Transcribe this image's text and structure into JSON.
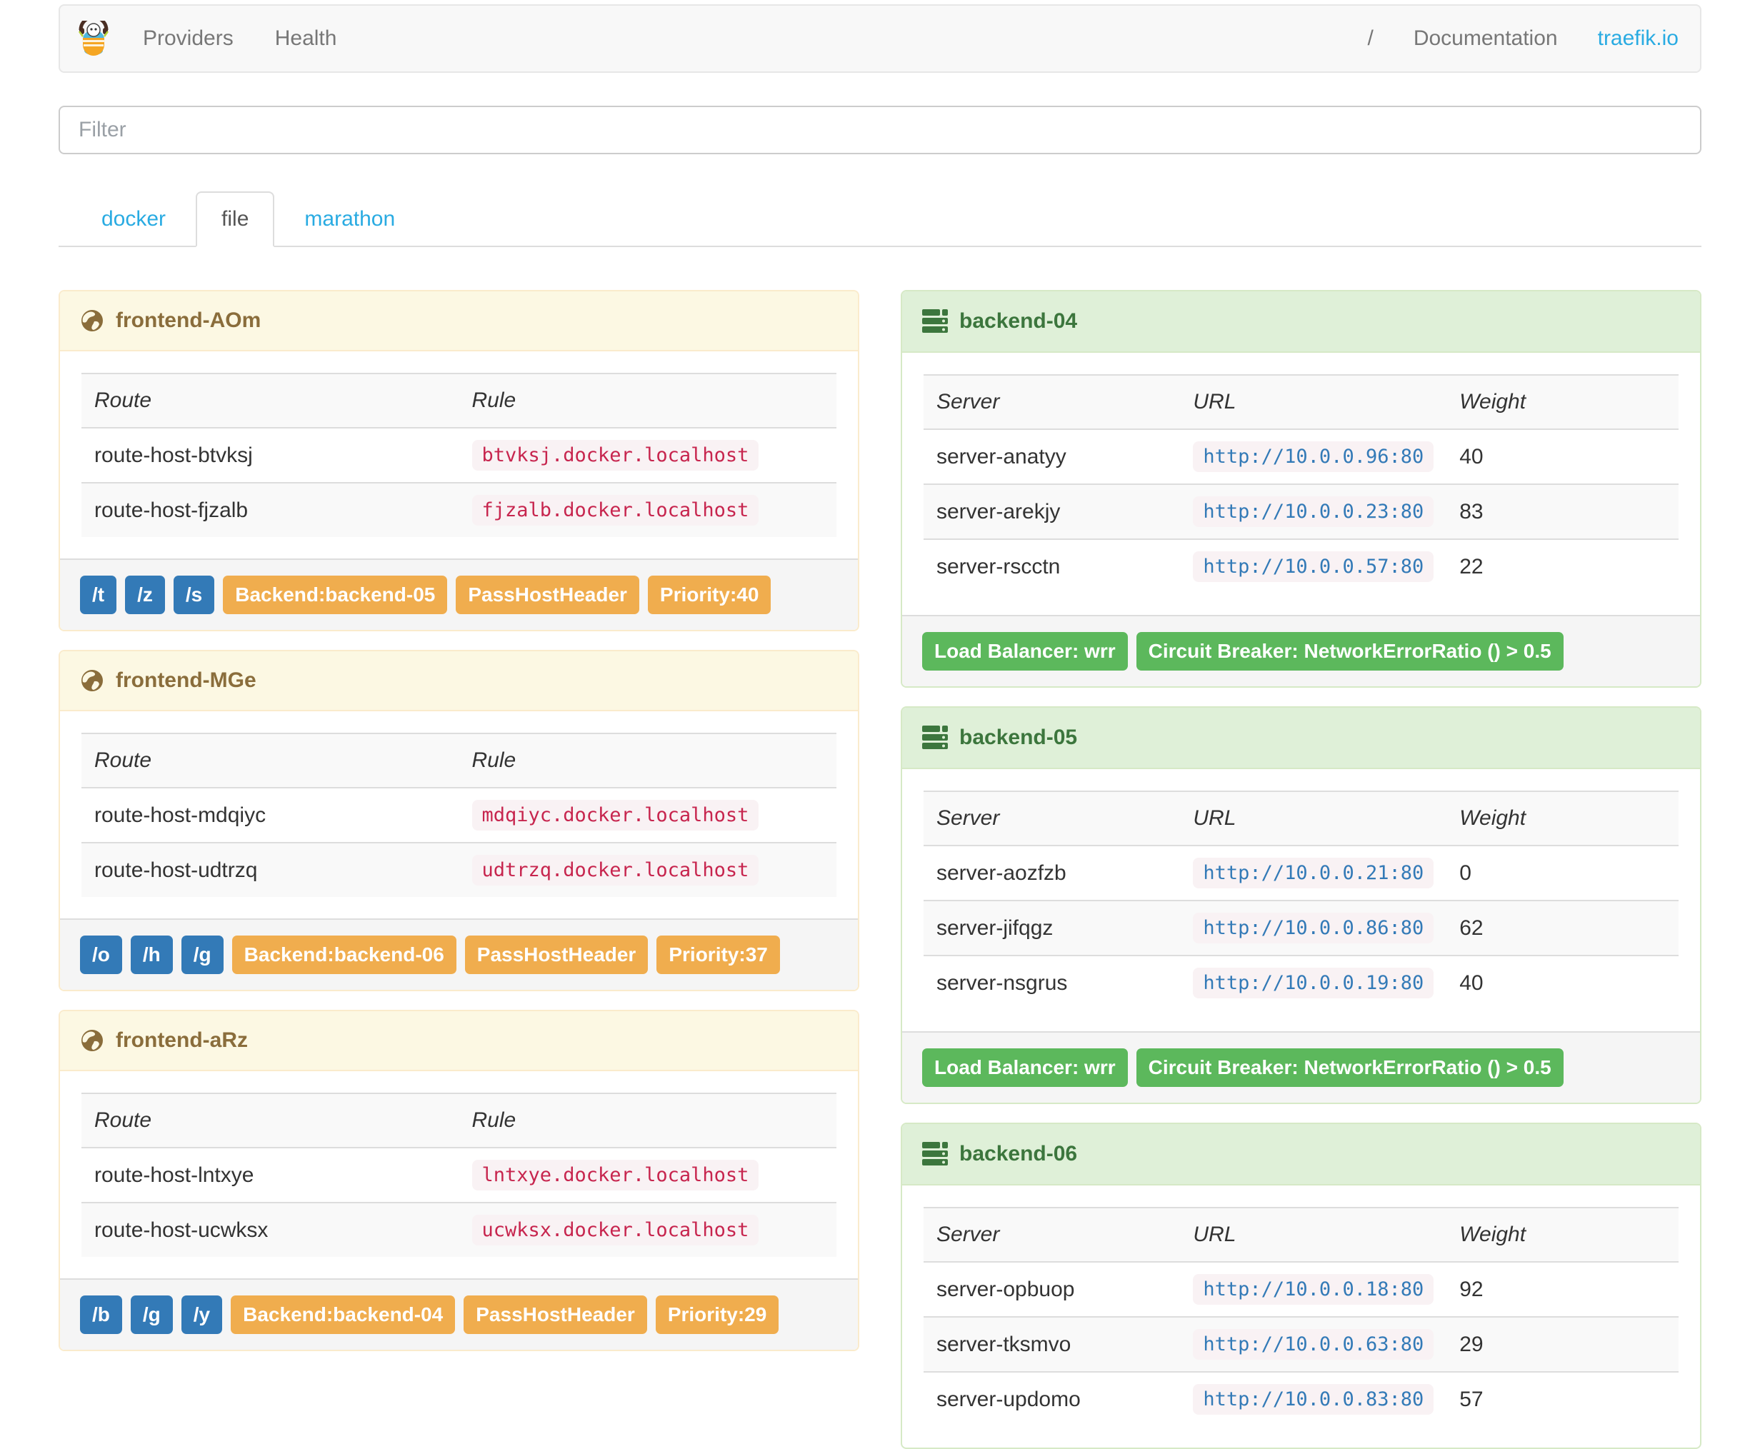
{
  "navbar": {
    "logo_icon": "traefik-logo",
    "items_left": [
      {
        "label": "Providers"
      },
      {
        "label": "Health"
      }
    ],
    "items_right": [
      {
        "label": "/"
      },
      {
        "label": "Documentation"
      }
    ],
    "brand_link": "traefik.io"
  },
  "filter": {
    "placeholder": "Filter"
  },
  "tabs": [
    {
      "label": "docker",
      "active": false
    },
    {
      "label": "file",
      "active": true
    },
    {
      "label": "marathon",
      "active": false
    }
  ],
  "table_labels": {
    "route": "Route",
    "rule": "Rule",
    "server": "Server",
    "url": "URL",
    "weight": "Weight"
  },
  "frontends": [
    {
      "name": "frontend-AOm",
      "icon": "globe-icon",
      "routes": [
        {
          "name": "route-host-btvksj",
          "rule": "btvksj.docker.localhost"
        },
        {
          "name": "route-host-fjzalb",
          "rule": "fjzalb.docker.localhost"
        }
      ],
      "entry_points": [
        "/t",
        "/z",
        "/s"
      ],
      "backend": "Backend:backend-05",
      "pass_host_header": "PassHostHeader",
      "priority": "Priority:40"
    },
    {
      "name": "frontend-MGe",
      "icon": "globe-icon",
      "routes": [
        {
          "name": "route-host-mdqiyc",
          "rule": "mdqiyc.docker.localhost"
        },
        {
          "name": "route-host-udtrzq",
          "rule": "udtrzq.docker.localhost"
        }
      ],
      "entry_points": [
        "/o",
        "/h",
        "/g"
      ],
      "backend": "Backend:backend-06",
      "pass_host_header": "PassHostHeader",
      "priority": "Priority:37"
    },
    {
      "name": "frontend-aRz",
      "icon": "globe-icon",
      "routes": [
        {
          "name": "route-host-lntxye",
          "rule": "lntxye.docker.localhost"
        },
        {
          "name": "route-host-ucwksx",
          "rule": "ucwksx.docker.localhost"
        }
      ],
      "entry_points": [
        "/b",
        "/g",
        "/y"
      ],
      "backend": "Backend:backend-04",
      "pass_host_header": "PassHostHeader",
      "priority": "Priority:29"
    }
  ],
  "backends": [
    {
      "name": "backend-04",
      "icon": "servers-icon",
      "servers": [
        {
          "name": "server-anatyy",
          "url": "http://10.0.0.96:80",
          "weight": "40"
        },
        {
          "name": "server-arekjy",
          "url": "http://10.0.0.23:80",
          "weight": "83"
        },
        {
          "name": "server-rscctn",
          "url": "http://10.0.0.57:80",
          "weight": "22"
        }
      ],
      "load_balancer": "Load Balancer: wrr",
      "circuit_breaker": "Circuit Breaker: NetworkErrorRatio () > 0.5"
    },
    {
      "name": "backend-05",
      "icon": "servers-icon",
      "servers": [
        {
          "name": "server-aozfzb",
          "url": "http://10.0.0.21:80",
          "weight": "0"
        },
        {
          "name": "server-jifqgz",
          "url": "http://10.0.0.86:80",
          "weight": "62"
        },
        {
          "name": "server-nsgrus",
          "url": "http://10.0.0.19:80",
          "weight": "40"
        }
      ],
      "load_balancer": "Load Balancer: wrr",
      "circuit_breaker": "Circuit Breaker: NetworkErrorRatio () > 0.5"
    },
    {
      "name": "backend-06",
      "icon": "servers-icon",
      "servers": [
        {
          "name": "server-opbuop",
          "url": "http://10.0.0.18:80",
          "weight": "92"
        },
        {
          "name": "server-tksmvo",
          "url": "http://10.0.0.63:80",
          "weight": "29"
        },
        {
          "name": "server-updomo",
          "url": "http://10.0.0.83:80",
          "weight": "57"
        }
      ]
    }
  ],
  "colors": {
    "link_blue": "#29abe2",
    "badge_blue": "#337ab7",
    "badge_orange": "#f0ad4e",
    "badge_green": "#5cb85c",
    "frontend_header_bg": "#fcf8e3",
    "frontend_header_text": "#8a6d3b",
    "backend_header_bg": "#dff0d8",
    "backend_header_text": "#3c763d",
    "code_text": "#c7254e",
    "code_url_text": "#337ab7",
    "code_bg": "#f9f2f4",
    "navbar_bg": "#f8f8f8",
    "stripe_bg": "#f9f9f9"
  }
}
